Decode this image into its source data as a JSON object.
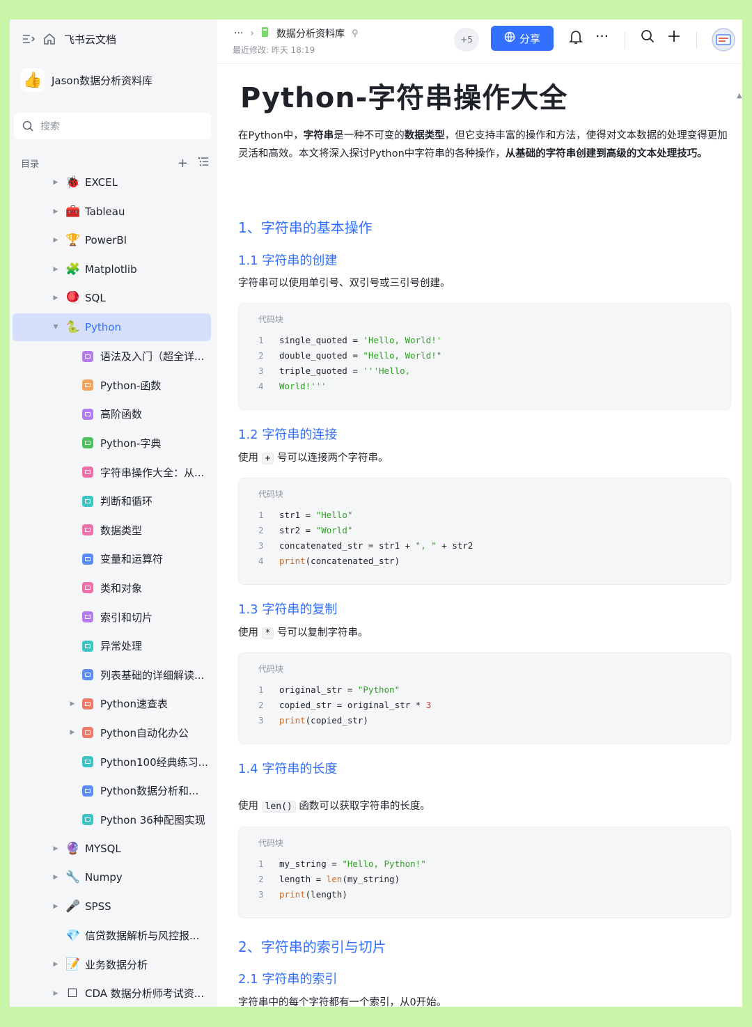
{
  "sidebar": {
    "app_name": "飞书云文档",
    "library_name": "Jason数据分析资料库",
    "search_placeholder": "搜索",
    "toc_label": "目录",
    "items": [
      {
        "label": "EXCEL",
        "level": 0,
        "arrow": true,
        "icon": "🐞"
      },
      {
        "label": "Tableau",
        "level": 0,
        "arrow": true,
        "icon": "🧰"
      },
      {
        "label": "PowerBI",
        "level": 0,
        "arrow": true,
        "icon": "🏆"
      },
      {
        "label": "Matplotlib",
        "level": 0,
        "arrow": true,
        "icon": "🧩"
      },
      {
        "label": "SQL",
        "level": 0,
        "arrow": true,
        "icon": "🪀"
      },
      {
        "label": "Python",
        "level": 0,
        "arrow": true,
        "icon": "🐍",
        "active": true,
        "expanded": true
      },
      {
        "label": "语法及入门（超全详...",
        "level": 1,
        "color": "#b57bf0"
      },
      {
        "label": "Python-函数",
        "level": 1,
        "color": "#f5a25d"
      },
      {
        "label": "高阶函数",
        "level": 1,
        "color": "#b57bf0"
      },
      {
        "label": "Python-字典",
        "level": 1,
        "color": "#4cc25a"
      },
      {
        "label": "字符串操作大全：从...",
        "level": 1,
        "color": "#f06fa8"
      },
      {
        "label": "判断和循环",
        "level": 1,
        "color": "#3cc4c4"
      },
      {
        "label": "数据类型",
        "level": 1,
        "color": "#f06fa8"
      },
      {
        "label": "变量和运算符",
        "level": 1,
        "color": "#5a8cf5"
      },
      {
        "label": "类和对象",
        "level": 1,
        "color": "#f06fa8"
      },
      {
        "label": "索引和切片",
        "level": 1,
        "color": "#b57bf0"
      },
      {
        "label": "异常处理",
        "level": 1,
        "color": "#3cc4c4"
      },
      {
        "label": "列表基础的详细解读...",
        "level": 1,
        "color": "#5a8cf5"
      },
      {
        "label": "Python速查表",
        "level": 1,
        "arrow": true,
        "color": "#f07a6a"
      },
      {
        "label": "Python自动化办公",
        "level": 1,
        "arrow": true,
        "color": "#f07a6a"
      },
      {
        "label": "Python100经典练习...",
        "level": 1,
        "color": "#3cc4c4"
      },
      {
        "label": "Python数据分析和...",
        "level": 1,
        "color": "#5a8cf5"
      },
      {
        "label": "Python 36种配图实现",
        "level": 1,
        "color": "#3cc4c4"
      },
      {
        "label": "MYSQL",
        "level": 0,
        "arrow": true,
        "icon": "🔮"
      },
      {
        "label": "Numpy",
        "level": 0,
        "arrow": true,
        "icon": "🔧"
      },
      {
        "label": "SPSS",
        "level": 0,
        "arrow": true,
        "icon": "🎤"
      },
      {
        "label": "信贷数据解析与风控报...",
        "level": 0,
        "icon": "💎"
      },
      {
        "label": "业务数据分析",
        "level": 0,
        "arrow": true,
        "icon": "📝"
      },
      {
        "label": "CDA 数据分析师考试资...",
        "level": 0,
        "arrow": true,
        "icon": "☐"
      }
    ]
  },
  "header": {
    "ellipsis": "···",
    "breadcrumb": "数据分析资料库",
    "last_modified": "最近修改: 昨天 18:19",
    "collaborators_more": "+5",
    "share_label": "分享"
  },
  "doc": {
    "title": "Python-字符串操作大全",
    "intro_1": "在Python中，",
    "intro_b1": "字符串",
    "intro_2": "是一种不可变的",
    "intro_b2": "数据类型",
    "intro_3": "，但它支持丰富的操作和方法，使得对文本数据的处理变得更加灵活和高效。本文将深入探讨Python中字符串的各种操作，",
    "intro_b3": "从基础的字符串创建到高级的文本处理技巧。",
    "h_1": "1、字符串的基本操作",
    "h_1_1": "1.1 字符串的创建",
    "p_1_1": "字符串可以使用单引号、双引号或三引号创建。",
    "code_label": "代码块",
    "h_1_2": "1.2 字符串的连接",
    "p_1_2_a": "使用",
    "p_1_2_op": "+",
    "p_1_2_b": "号可以连接两个字符串。",
    "h_1_3": "1.3 字符串的复制",
    "p_1_3_a": "使用",
    "p_1_3_op": "*",
    "p_1_3_b": "号可以复制字符串。",
    "h_1_4": "1.4 字符串的长度",
    "p_1_4_a": "使用",
    "p_1_4_op": "len()",
    "p_1_4_b": "函数可以获取字符串的长度。",
    "h_2": "2、字符串的索引与切片",
    "h_2_1": "2.1 字符串的索引",
    "p_2_1": "字符串中的每个字符都有一个索引，从0开始。"
  },
  "code_blocks": [
    [
      [
        [
          "single_quoted = ",
          ""
        ],
        [
          "'Hello, World!'",
          "str"
        ]
      ],
      [
        [
          "double_quoted = ",
          ""
        ],
        [
          "\"Hello, World!\"",
          "str"
        ]
      ],
      [
        [
          "triple_quoted = ",
          ""
        ],
        [
          "'''Hello,",
          "str"
        ]
      ],
      [
        [
          "World!'''",
          "str"
        ]
      ]
    ],
    [
      [
        [
          "str1 = ",
          ""
        ],
        [
          "\"Hello\"",
          "str"
        ]
      ],
      [
        [
          "str2 = ",
          ""
        ],
        [
          "\"World\"",
          "str"
        ]
      ],
      [
        [
          "concatenated_str = str1 + ",
          ""
        ],
        [
          "\", \"",
          "str"
        ],
        [
          " + str2",
          ""
        ]
      ],
      [
        [
          "print",
          "fn"
        ],
        [
          "(concatenated_str)",
          ""
        ]
      ]
    ],
    [
      [
        [
          "original_str = ",
          ""
        ],
        [
          "\"Python\"",
          "str"
        ]
      ],
      [
        [
          "copied_str = original_str * ",
          ""
        ],
        [
          "3",
          "num"
        ]
      ],
      [
        [
          "print",
          "fn"
        ],
        [
          "(copied_str)",
          ""
        ]
      ]
    ],
    [
      [
        [
          "my_string = ",
          ""
        ],
        [
          "\"Hello, Python!\"",
          "str"
        ]
      ],
      [
        [
          "length = ",
          ""
        ],
        [
          "len",
          "fn"
        ],
        [
          "(my_string)",
          ""
        ]
      ],
      [
        [
          "print",
          "fn"
        ],
        [
          "(length)",
          ""
        ]
      ]
    ]
  ]
}
